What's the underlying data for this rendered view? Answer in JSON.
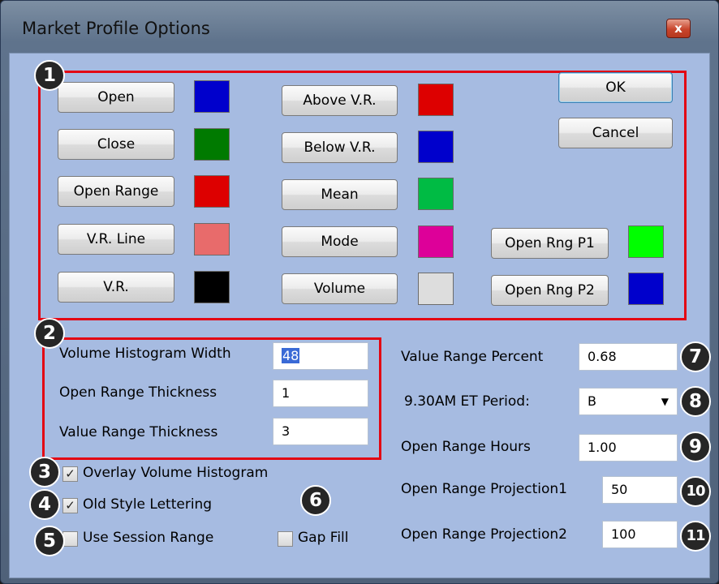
{
  "window": {
    "title": "Market Profile Options",
    "close_label": "x"
  },
  "colors": {
    "open": "#0000cc",
    "close": "#007a00",
    "open_range": "#dd0000",
    "vr_line": "#e86b6b",
    "vr": "#000000",
    "above_vr": "#dd0000",
    "below_vr": "#0000cc",
    "mean": "#00bb44",
    "mode": "#dd0099",
    "volume": "#dddddd",
    "open_rng_p1": "#00ff00",
    "open_rng_p2": "#0000cc"
  },
  "buttons": {
    "open": "Open",
    "close": "Close",
    "open_range": "Open Range",
    "vr_line": "V.R. Line",
    "vr": "V.R.",
    "above_vr": "Above V.R.",
    "below_vr": "Below V.R.",
    "mean": "Mean",
    "mode": "Mode",
    "volume": "Volume",
    "open_rng_p1": "Open Rng P1",
    "open_rng_p2": "Open Rng P2",
    "ok": "OK",
    "cancel": "Cancel"
  },
  "settings": {
    "volume_histogram_width": {
      "label": "Volume Histogram Width",
      "value": "48"
    },
    "open_range_thickness": {
      "label": "Open Range Thickness",
      "value": "1"
    },
    "value_range_thickness": {
      "label": "Value Range Thickness",
      "value": "3"
    },
    "value_range_percent": {
      "label": "Value Range Percent",
      "value": "0.68"
    },
    "et_period": {
      "label": "9.30AM ET Period:",
      "value": "B"
    },
    "open_range_hours": {
      "label": "Open Range Hours",
      "value": "1.00"
    },
    "open_range_projection1": {
      "label": "Open Range Projection1",
      "value": "50"
    },
    "open_range_projection2": {
      "label": "Open Range Projection2",
      "value": "100"
    }
  },
  "checkboxes": {
    "overlay_volume_histogram": {
      "label": "Overlay Volume Histogram",
      "checked": true,
      "mark": "✓"
    },
    "old_style_lettering": {
      "label": "Old Style Lettering",
      "checked": true,
      "mark": "✓"
    },
    "use_session_range": {
      "label": "Use Session Range",
      "checked": false,
      "mark": ""
    },
    "gap_fill": {
      "label": "Gap Fill",
      "checked": false,
      "mark": ""
    }
  },
  "callouts": [
    "1",
    "2",
    "3",
    "4",
    "5",
    "6",
    "7",
    "8",
    "9",
    "10",
    "11"
  ]
}
